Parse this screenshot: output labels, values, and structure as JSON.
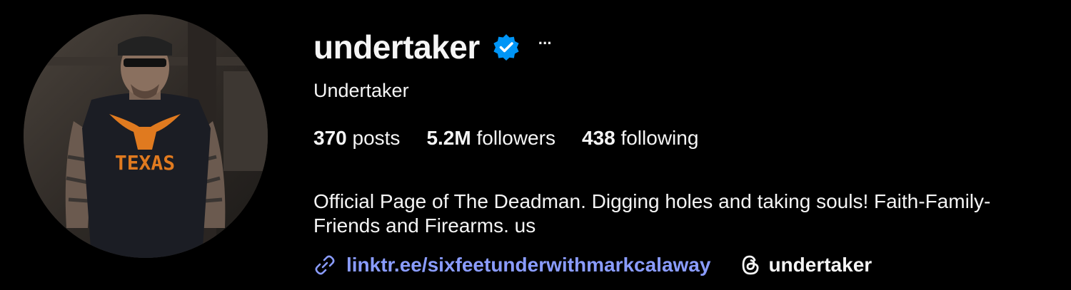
{
  "profile": {
    "username": "undertaker",
    "display_name": "Undertaker",
    "more_label": "···",
    "stats": [
      {
        "count": "370",
        "label": "posts"
      },
      {
        "count": "5.2M",
        "label": "followers"
      },
      {
        "count": "438",
        "label": "following"
      }
    ],
    "bio_lines": [
      "Official Page of The Deadman. Digging holes and taking souls! Faith-Family-",
      "Friends and Firearms. us"
    ],
    "external_link": "linktr.ee/sixfeetunderwithmarkcalaway",
    "threads_handle": "undertaker",
    "avatar_shirt_text": "TEXAS"
  },
  "colors": {
    "background": "#000000",
    "text": "#f5f5f5",
    "link": "#8a9cff",
    "verified_badge": "#0095f6",
    "shirt_accent": "#e07a1f"
  },
  "icons": {
    "verified": "verified-badge-icon",
    "more": "more-options-icon",
    "link": "link-icon",
    "threads": "threads-icon"
  }
}
